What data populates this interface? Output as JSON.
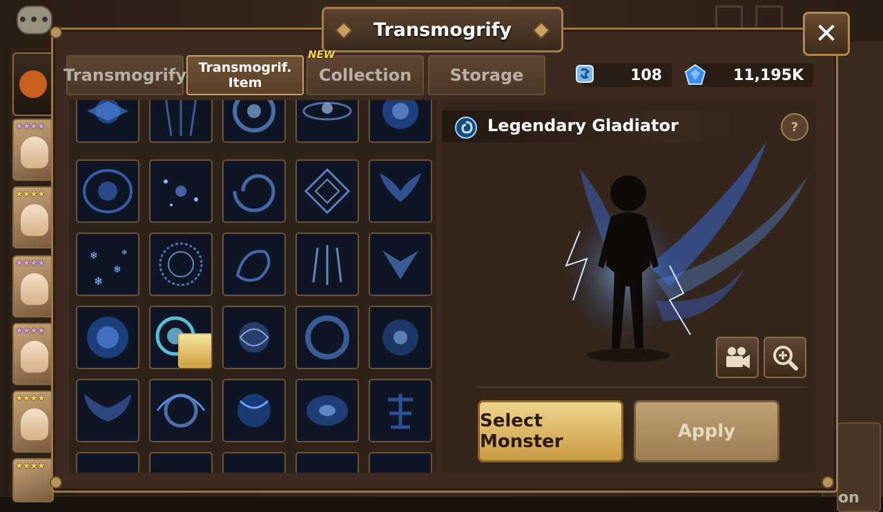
{
  "window_title": "Transmogrify",
  "tabs": [
    {
      "label": "Transmogrify",
      "active": false
    },
    {
      "label": "Transmogrif. Item",
      "active": true
    },
    {
      "label": "Collection",
      "active": false,
      "badge": "NEW"
    },
    {
      "label": "Storage",
      "active": false
    }
  ],
  "currency": [
    {
      "icon": "transmog-stone-icon",
      "value": "108"
    },
    {
      "icon": "crystal-icon",
      "value": "11,195K"
    }
  ],
  "preview": {
    "name": "Legendary Gladiator"
  },
  "buttons": {
    "select_monster": "Select Monster",
    "apply": "Apply"
  },
  "side_partial_text": "on",
  "help_label": "?",
  "colors": {
    "accent_gold": "#c9a468",
    "panel_brown": "#3b2a1d",
    "effect_blue": "#3a7aff"
  }
}
